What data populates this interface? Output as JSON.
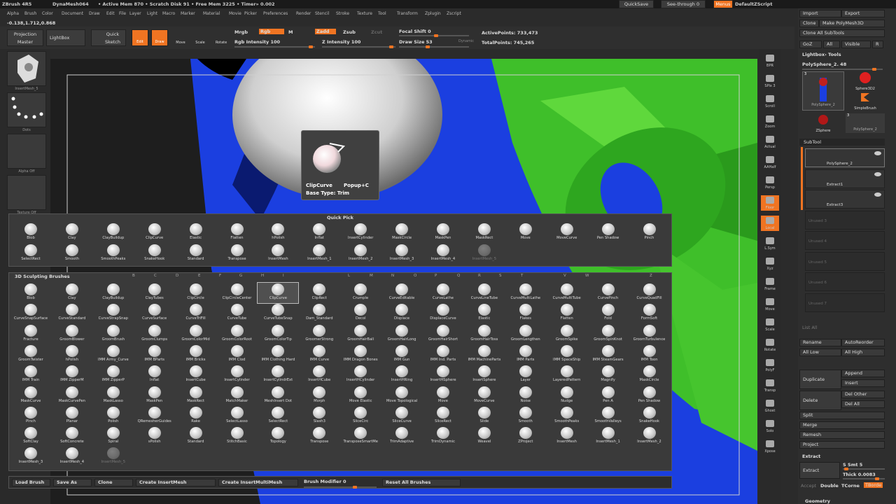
{
  "titlebar": {
    "app": "ZBrush 4R5",
    "mesh": "DynaMesh064",
    "status": "• Active Mem 870 • Scratch Disk 91 • Free Mem 3225 • Timer» 0.002",
    "quicksave": "QuickSave",
    "seethrough": "See-through 0",
    "menus": "Menus",
    "script": "DefaultZScript"
  },
  "menubar": [
    "Alpha",
    "Brush",
    "Color",
    "Document",
    "Draw",
    "Edit",
    "File",
    "Layer",
    "Light",
    "Macro",
    "Marker",
    "Material",
    "Movie",
    "Picker",
    "Preferences",
    "Render",
    "Stencil",
    "Stroke",
    "Texture",
    "Tool",
    "Transform",
    "Zplugin",
    "Zscript"
  ],
  "coords": "-0.138,1.712,0.868",
  "toolbar": {
    "projection_master": "Projection Master",
    "lightbox": "LightBox",
    "quick_sketch": "Quick Sketch",
    "edit": "Edit",
    "draw": "Draw",
    "move": "Move",
    "scale": "Scale",
    "rotate": "Rotate",
    "mrgb": "Mrgb",
    "rgb": "Rgb",
    "m": "M",
    "rgb_intensity": "Rgb Intensity 100",
    "zadd": "Zadd",
    "zsub": "Zsub",
    "zcut": "Zcut",
    "z_intensity": "Z Intensity 100",
    "focal_shift": "Focal Shift 0",
    "draw_size": "Draw Size 53",
    "dynamic": "Dynamic",
    "active_points": "ActivePoints: 733,473",
    "total_points": "TotalPoints: 745,265"
  },
  "leftshelf": [
    {
      "label": "InsertMesh_5"
    },
    {
      "label": "Dots"
    },
    {
      "label": "Alpha Off"
    },
    {
      "label": "Texture Off"
    }
  ],
  "popup": {
    "title": "ClipCurve",
    "shortcut": "Popup+C",
    "base_type": "Base Type: Trim"
  },
  "quickpick": {
    "title": "Quick Pick",
    "items": [
      "Blob",
      "Clay",
      "ClayBuildup",
      "ClipCurve",
      "Elastic",
      "Flatten",
      "hPolish",
      "Inflat",
      "InsertCylinder",
      "MaskCircle",
      "MaskPen",
      "MaskRect",
      "Move",
      "MoveCurve",
      "Pen Shadow",
      "Pinch",
      "SelectRect",
      "Smooth",
      "SmoothPeaks",
      "SnakeHook",
      "Standard",
      "Transpose",
      "InsertMesh",
      "InsertMesh_1",
      "InsertMesh_2",
      "InsertMesh_3",
      "InsertMesh_4",
      "InsertMesh_5"
    ]
  },
  "brushes": {
    "title": "3D Sculpting Brushes",
    "letters": [
      "B",
      "C",
      "D",
      "E",
      "F",
      "G",
      "H",
      "I",
      "L",
      "M",
      "N",
      "O",
      "P",
      "Q",
      "R",
      "S",
      "T",
      "V",
      "W",
      "Z"
    ],
    "items": [
      "Blob",
      "Clay",
      "ClayBuildup",
      "ClayTubes",
      "ClipCircle",
      "ClipCircleCenter",
      "ClipCurve",
      "ClipRect",
      "Crumple",
      "CurveEditable",
      "CurveLathe",
      "CurveLineTube",
      "CurveMultiLathe",
      "CurveMultiTube",
      "CurvePinch",
      "CurveQuadFill",
      "CurveSnapSurface",
      "CurveStandard",
      "CurveStrapSnap",
      "CurveSurface",
      "CurveTriFill",
      "CurveTube",
      "CurveTubeSnap",
      "Dam_Standard",
      "Decol",
      "Displace",
      "DisplaceCurve",
      "Elastic",
      "Flakes",
      "Flatten",
      "Fold",
      "FormSoft",
      "Fracture",
      "GroomBlower",
      "GroomBrush",
      "GroomClumps",
      "GroomColorMid",
      "GroomColorRoot",
      "GroomColorTip",
      "GroomerStrong",
      "GroomHairBall",
      "GroomHairLong",
      "GroomHairShort",
      "GroomHairToss",
      "GroomLengthen",
      "GroomSpike",
      "GroomSpinKnot",
      "GroomTurbulence",
      "GroomTwister",
      "hPolish",
      "IMM Army_Curve",
      "IMM BParts",
      "IMM Bricks",
      "IMM Clod",
      "IMM Clothing Hard",
      "IMM Curve",
      "IMM Dragon Bones",
      "IMM Gun",
      "IMM Ind. Parts",
      "IMM MachineParts",
      "IMM Parts",
      "IMM SpaceShip",
      "IMM SteamGears",
      "IMM Toon",
      "IMM Train",
      "IMM ZipperM",
      "IMM ZipperP",
      "Inflat",
      "InsertCube",
      "InsertCylinder",
      "InsertCylindrExt",
      "InsertHCube",
      "InsertHCylinder",
      "InsertHRing",
      "InsertHSphere",
      "InsertSphere",
      "Layer",
      "LayeredPattern",
      "Magnify",
      "MaskCircle",
      "MaskCurve",
      "MaskCurvePen",
      "MaskLasso",
      "MaskPen",
      "MaskRect",
      "MatchMaker",
      "MeshInsert Dot",
      "Morph",
      "Move Elastic",
      "Move Topological",
      "Move",
      "MoveCurve",
      "Noise",
      "Nudge",
      "Pen A",
      "Pen Shadow",
      "Pinch",
      "Planar",
      "Polish",
      "QRemesherGuides",
      "Rake",
      "SelectLasso",
      "SelectRect",
      "Slash3",
      "SliceCirc",
      "SliceCurve",
      "SliceRect",
      "Slide",
      "Smooth",
      "SmoothPeaks",
      "SmoothValleys",
      "SnakeHook",
      "SoftClay",
      "SoftConcrete",
      "Spiral",
      "sPolish",
      "Standard",
      "StitchBasic",
      "Topology",
      "Transpose",
      "TransposeSmartMe",
      "TrimAdaptive",
      "TrimDynamic",
      "Weavel",
      "ZProject",
      "InsertMesh",
      "InsertMesh_1",
      "InsertMesh_2",
      "InsertMesh_3",
      "InsertMesh_4",
      "InsertMesh_5"
    ]
  },
  "bottombar": {
    "load_brush": "Load Brush",
    "save_as": "Save As",
    "clone": "Clone",
    "create_insertmesh": "Create InsertMesh",
    "create_insertmultimesh": "Create InsertMultiMesh",
    "brush_modifier": "Brush Modifier 0",
    "reset_all": "Reset All Brushes"
  },
  "rightshelf": [
    "BPR",
    "SPix 3",
    "Scroll",
    "Zoom",
    "Actual",
    "AAHalf",
    "Persp",
    "Floor",
    "Local",
    "L.Sym",
    "Xyz",
    "Frame",
    "Move",
    "Scale",
    "Rotate",
    "PolyF",
    "Transp",
    "Ghost",
    "Solo",
    "Xpose"
  ],
  "rightpanel": {
    "import": "Import",
    "export": "Export",
    "clone": "Clone",
    "make_polymesh": "Make PolyMesh3D",
    "clone_all": "Clone All SubTools",
    "goz": "GoZ",
    "all": "All",
    "visible": "Visible",
    "r": "R",
    "lightbox_tools": "Lightbox› Tools",
    "current_tool": "PolySphere_2. 48",
    "tools": [
      "PolySphere_2",
      "Sphere3D2",
      "SimpleBrush",
      "ZSphere",
      "PolySphere_2"
    ],
    "tool_counts": [
      "3",
      "3"
    ],
    "subtool_title": "SubTool",
    "subtools": [
      "PolySphere_2",
      "Extract1",
      "Extract3",
      "Unused 3",
      "Unused 4",
      "Unused 5",
      "Unused 6",
      "Unused 7"
    ],
    "list_all": "List All",
    "rename": "Rename",
    "autoreorder": "AutoReorder",
    "all_low": "All Low",
    "all_high": "All High",
    "duplicate": "Duplicate",
    "append": "Append",
    "insert": "Insert",
    "delete": "Delete",
    "del_other": "Del Other",
    "del_all": "Del All",
    "split": "Split",
    "merge": "Merge",
    "remesh": "Remesh",
    "project": "Project",
    "extract_title": "Extract",
    "extract": "Extract",
    "s_smt": "S Smt 5",
    "thick": "Thick 0.0083",
    "accept": "Accept",
    "double": "Double",
    "tcorne": "TCorne",
    "tborde": "TBorde",
    "geometry": "Geometry"
  },
  "colors": {
    "accent": "#f07422",
    "panel": "#3a3a3a",
    "viewport_blue": "#1b3fe0",
    "leaf_green": "#3fbf2a"
  }
}
